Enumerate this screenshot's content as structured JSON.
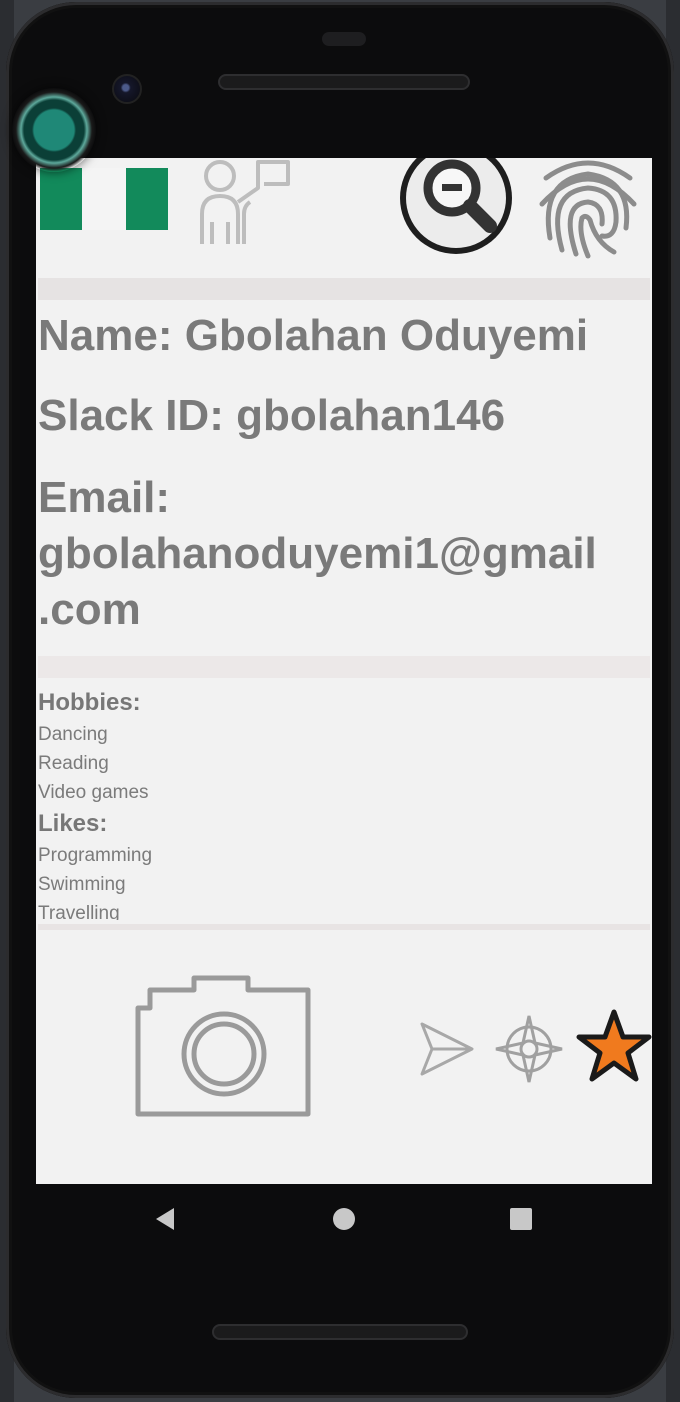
{
  "profile": {
    "name_line": "Name: Gbolahan Oduyemi",
    "slack_line": "Slack ID: gbolahan146",
    "email_line_1": "Email:",
    "email_line_2": "gbolahanoduyemi1@gmail",
    "email_line_3": ".com"
  },
  "hobbies": {
    "title": "Hobbies:",
    "items": [
      "Dancing",
      "Reading",
      "Video games"
    ]
  },
  "likes": {
    "title": "Likes:",
    "items": [
      "Programming",
      "Swimming",
      "Travelling"
    ]
  },
  "header_icons": [
    "nigeria-flag-icon",
    "people-icon",
    "zoom-out-icon",
    "fingerprint-icon"
  ],
  "footer_icons": [
    "camera-icon",
    "send-icon",
    "compass-icon",
    "star-icon"
  ],
  "nav_icons": [
    "back-icon",
    "home-icon",
    "recents-icon"
  ],
  "colors": {
    "screen_bg": "#f2f2f2",
    "text_gray": "#7a7a7a",
    "flag_green": "#128a5b",
    "star_orange": "#f07a1e",
    "overlay_teal": "#1f8877"
  }
}
